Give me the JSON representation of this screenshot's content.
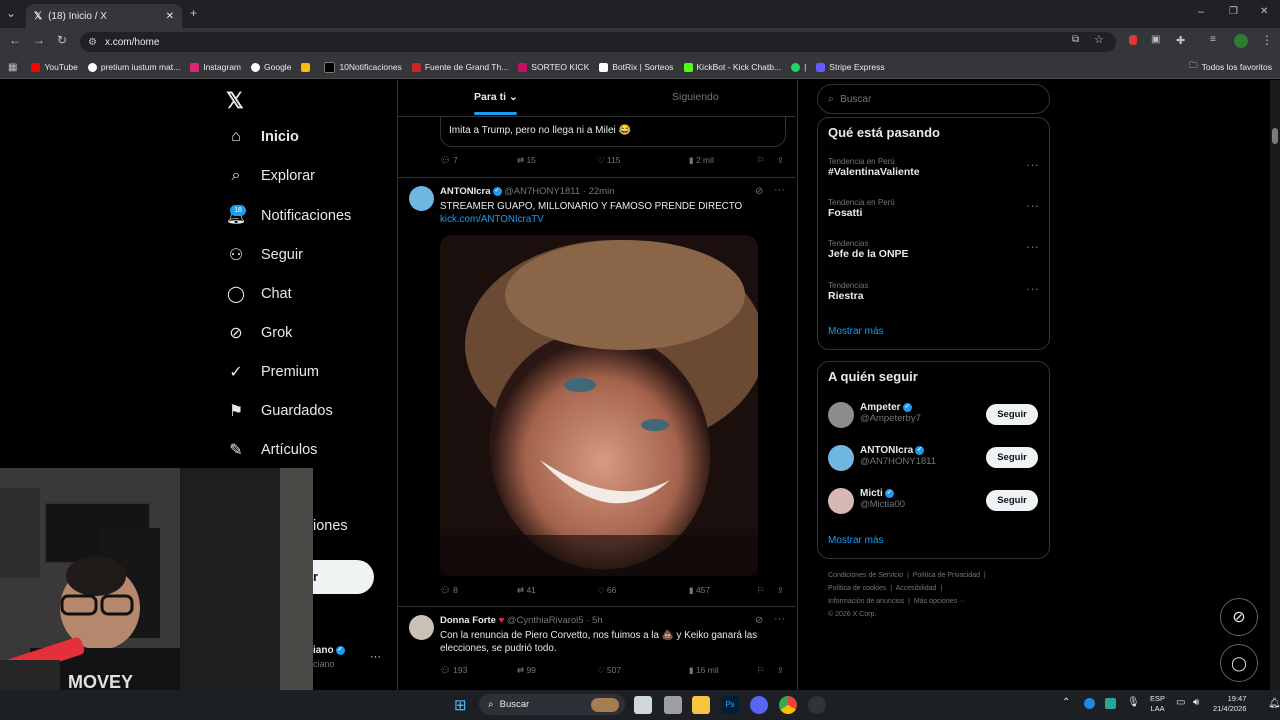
{
  "browser": {
    "tab_title": "(18) Inicio / X",
    "url": "x.com/home",
    "bookmarks": [
      "YouTube",
      "pretium iustum mat...",
      "Instagram",
      "Google",
      "10Notificaciones",
      "Fuente de Grand Th...",
      "SORTEO KICK",
      "BotRix | Sorteos",
      "KickBot - Kick Chatb...",
      "|",
      "Stripe Express"
    ],
    "all_bookmarks": "Todos los favoritos"
  },
  "nav": {
    "notif_badge": "18",
    "items": [
      "Inicio",
      "Explorar",
      "Notificaciones",
      "Seguir",
      "Chat",
      "Grok",
      "Premium",
      "Guardados",
      "Artículos"
    ],
    "partial_more": "iones",
    "post_button_partial": "r",
    "profile_name_partial": "iano",
    "profile_handle_partial": "ciano",
    "more_dots": "···"
  },
  "timeline": {
    "tabs": [
      "Para ti",
      "Siguiendo"
    ],
    "quoted_text": "Imita a Trump, pero no llega ni a Milei 😂",
    "post0_actions": {
      "replies": "7",
      "reposts": "15",
      "likes": "115",
      "views": "2 mil"
    },
    "post1": {
      "name": "ANTONIcra",
      "handle": "@AN7HONY1811",
      "time": "· 22min",
      "text": "STREAMER GUAPO, MILLONARIO Y FAMOSO PRENDE DIRECTO",
      "link": "kick.com/ANTONIcraTV",
      "actions": {
        "replies": "8",
        "reposts": "41",
        "likes": "66",
        "views": "457"
      }
    },
    "post2": {
      "name": "Donna Forte",
      "handle": "@CynthiaRivarol5",
      "time": "· 5h",
      "text1": "Con la renuncia de Piero Corvetto, nos fuimos a la 💩 y Keiko ganará las",
      "text2": "elecciones, se pudrió todo.",
      "actions": {
        "replies": "193",
        "reposts": "99",
        "likes": "507",
        "views": "16 mil"
      }
    }
  },
  "right": {
    "search_placeholder": "Buscar",
    "trends_title": "Qué está pasando",
    "trends": [
      {
        "context": "Tendencia en Perú",
        "name": "#ValentinaValiente"
      },
      {
        "context": "Tendencia en Perú",
        "name": "Fosatti"
      },
      {
        "context": "Tendencias",
        "name": "Jefe de la ONPE"
      },
      {
        "context": "Tendencias",
        "name": "Riestra"
      }
    ],
    "show_more": "Mostrar más",
    "who_title": "A quién seguir",
    "who": [
      {
        "name": "Ampeter",
        "handle": "@Ampeterby7"
      },
      {
        "name": "ANTONIcra",
        "handle": "@AN7HONY1811"
      },
      {
        "name": "Micti",
        "handle": "@Mictia00"
      }
    ],
    "follow_label": "Seguir",
    "footer": [
      "Condiciones de Servicio",
      "Política de Privacidad",
      "Política de cookies",
      "Accesibilidad",
      "Información de anuncios",
      "Más opciones ···",
      "© 2026 X Corp."
    ]
  },
  "taskbar": {
    "search": "Buscar",
    "lang": "ESP",
    "lang2": "LAA",
    "time": "19:47",
    "date": "21/4/2026"
  }
}
